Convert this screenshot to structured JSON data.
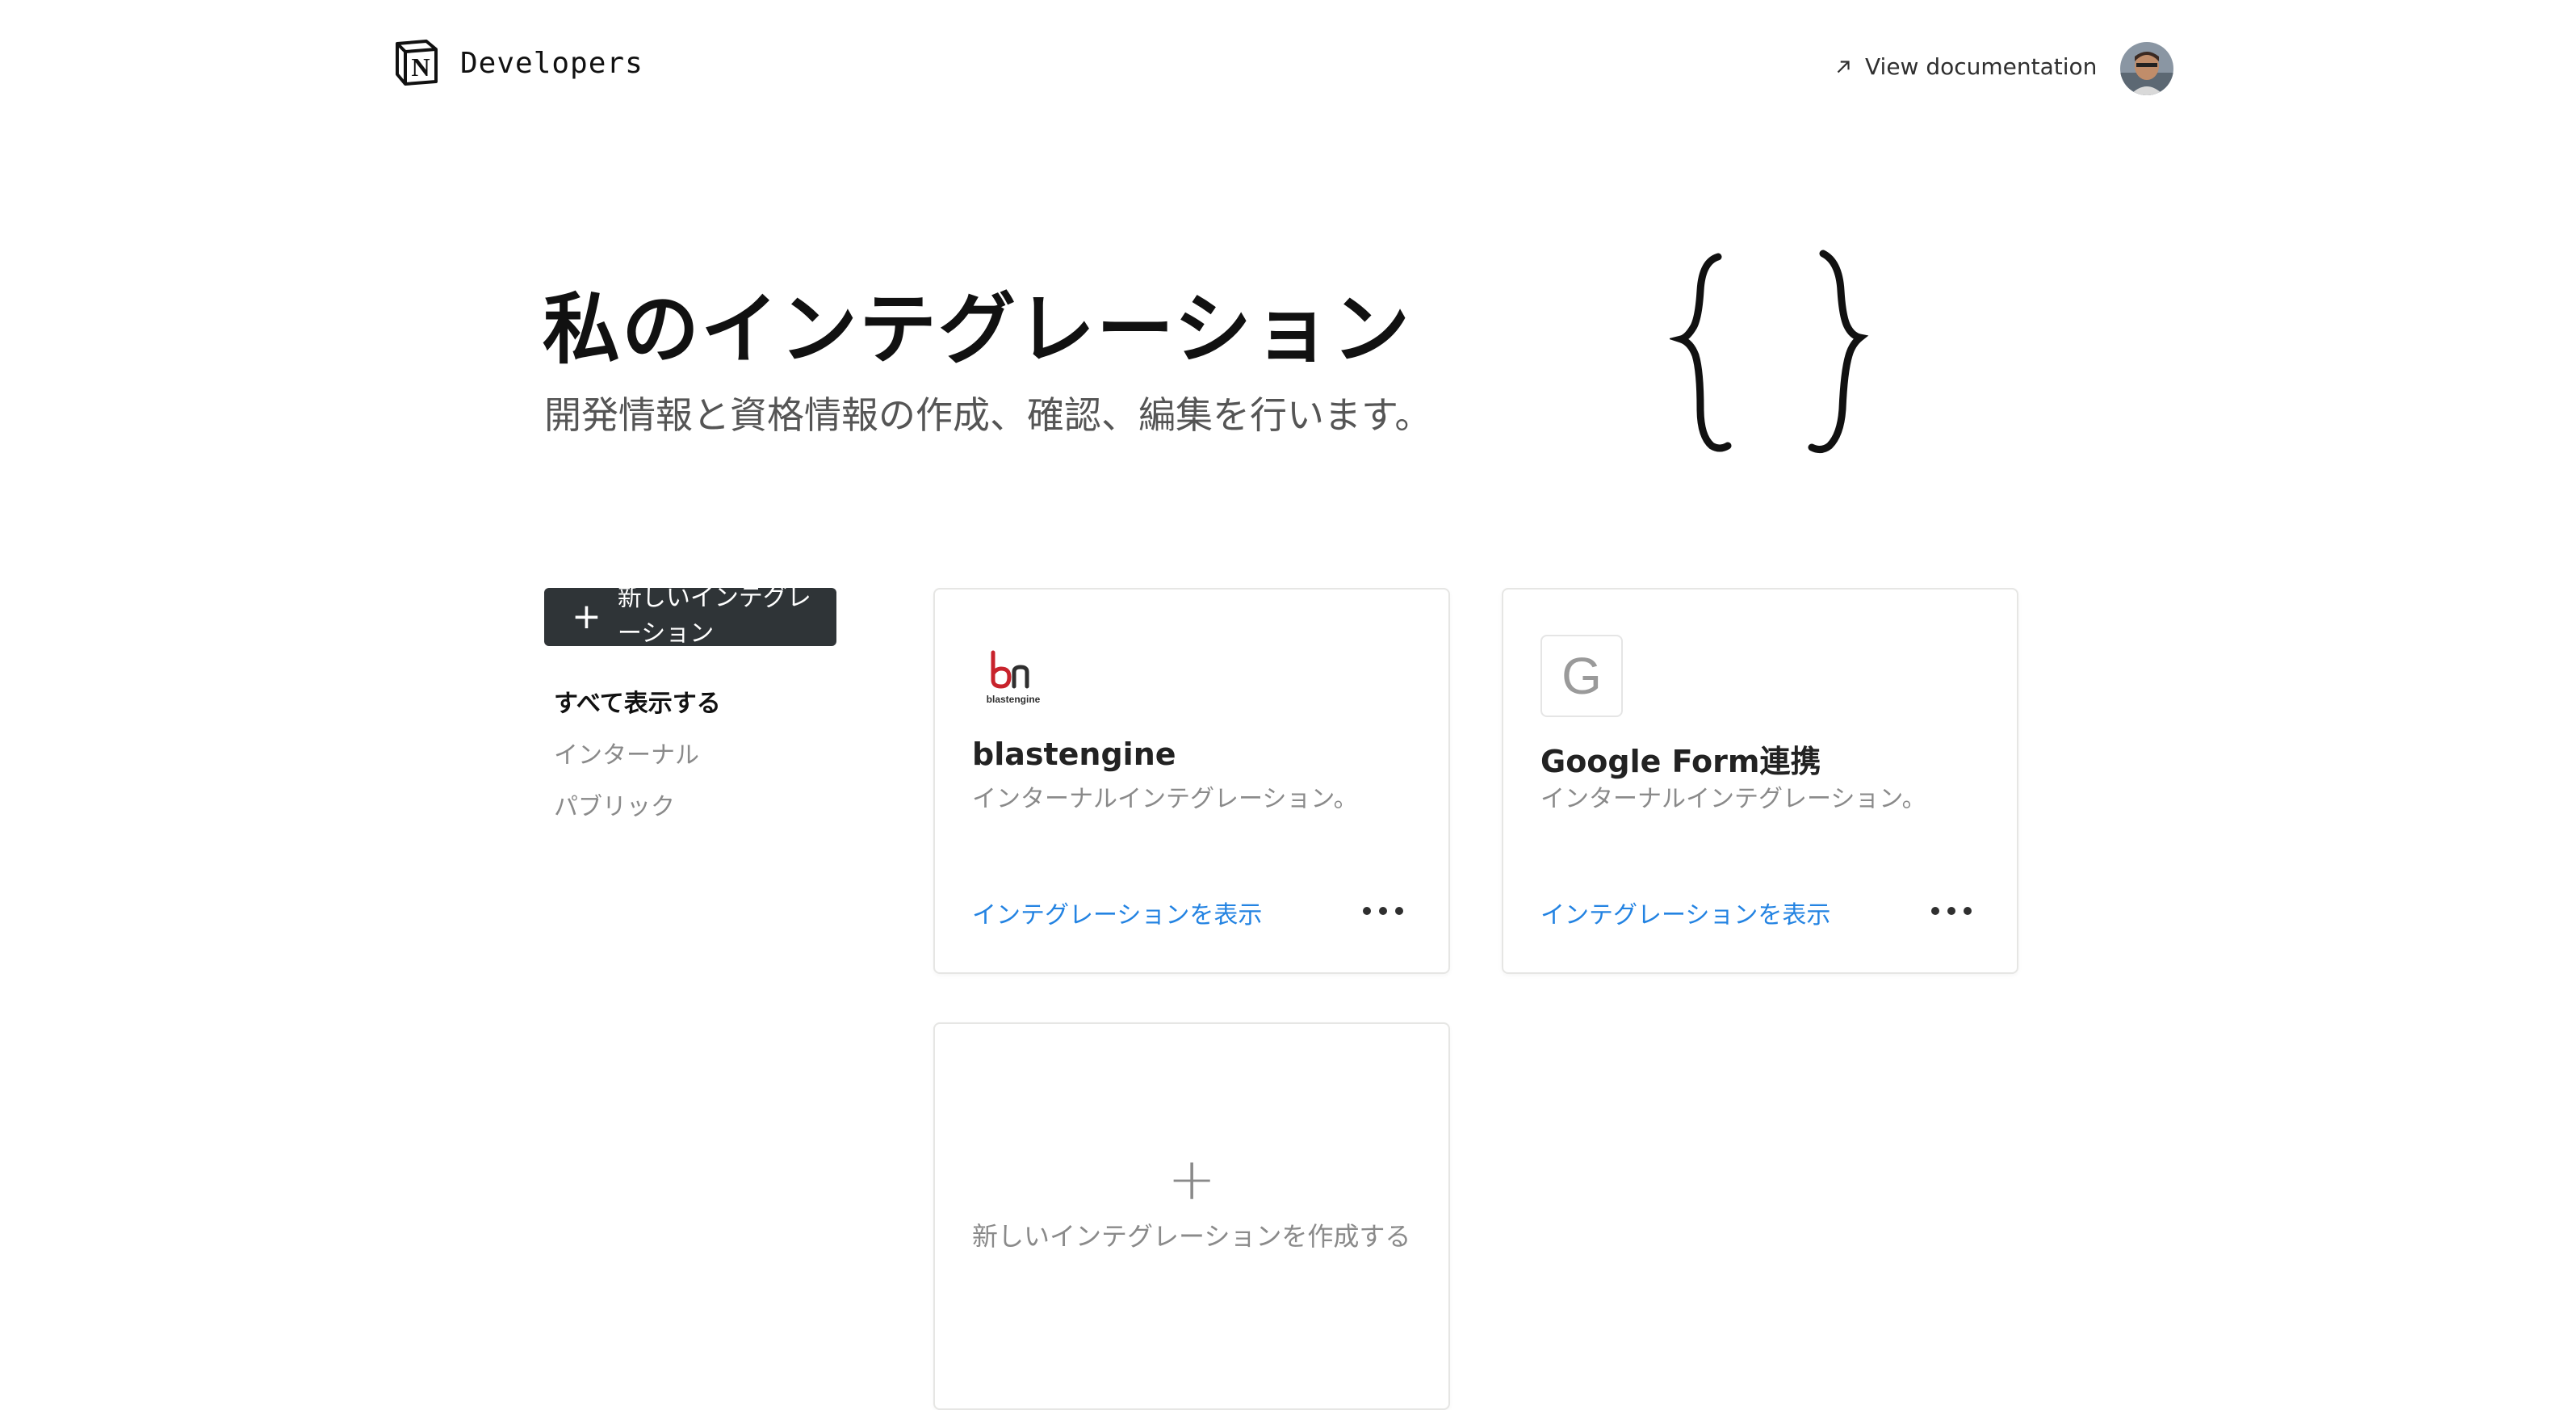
{
  "header": {
    "brand": "Developers",
    "doc_link": "View documentation"
  },
  "hero": {
    "title": "私のインテグレーション",
    "subtitle": "開発情報と資格情報の作成、確認、編集を行います。"
  },
  "sidebar": {
    "new_button_label": "新しいインテグレーション",
    "filters": [
      {
        "label": "すべて表示する",
        "active": true
      },
      {
        "label": "インターナル",
        "active": false
      },
      {
        "label": "パブリック",
        "active": false
      }
    ]
  },
  "cards": [
    {
      "title": "blastengine",
      "logo_text": "blastengine",
      "description": "インターナルインテグレーション。",
      "link": "インテグレーションを表示"
    },
    {
      "title": "Google Form連携",
      "logo_letter": "G",
      "description": "インターナルインテグレーション。",
      "link": "インテグレーションを表示"
    }
  ],
  "create_card": {
    "label": "新しいインテグレーションを作成する"
  },
  "colors": {
    "link": "#2383e2",
    "button_bg": "#2f3437",
    "blastengine_red": "#c8232c"
  },
  "icons": [
    "notion-logo-icon",
    "arrow-up-right-icon",
    "avatar",
    "braces-illustration",
    "plus-icon",
    "more-icon"
  ]
}
